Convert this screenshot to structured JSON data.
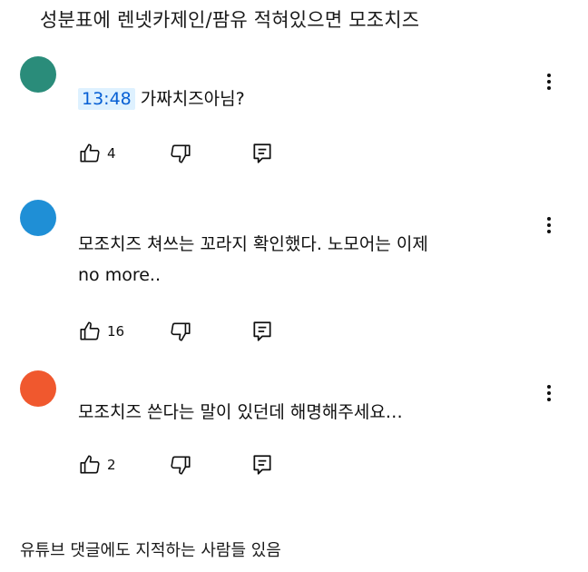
{
  "caption_top": "성분표에 렌넷카제인/팜유 적혀있으면 모조치즈",
  "caption_bottom": "유튜브 댓글에도 지적하는 사람들 있음",
  "colors": {
    "avatar_1": "#2a8c7a",
    "avatar_2": "#1f8fd6",
    "avatar_3": "#f0582e",
    "timestamp_bg": "#def1ff",
    "timestamp_text": "#065fd4"
  },
  "comments": [
    {
      "timestamp": "13:48",
      "text": "가짜치즈아님?",
      "likes": "4"
    },
    {
      "text_line1": "모조치즈 쳐쓰는 꼬라지 확인했다. 노모어는 이제",
      "text_line2": "no more..",
      "likes": "16"
    },
    {
      "text": "모조치즈 쓴다는 말이 있던데 해명해주세요…",
      "likes": "2"
    }
  ],
  "icons": {
    "like": "thumbs-up-icon",
    "dislike": "thumbs-down-icon",
    "reply": "reply-icon",
    "menu": "more-vert-icon"
  }
}
